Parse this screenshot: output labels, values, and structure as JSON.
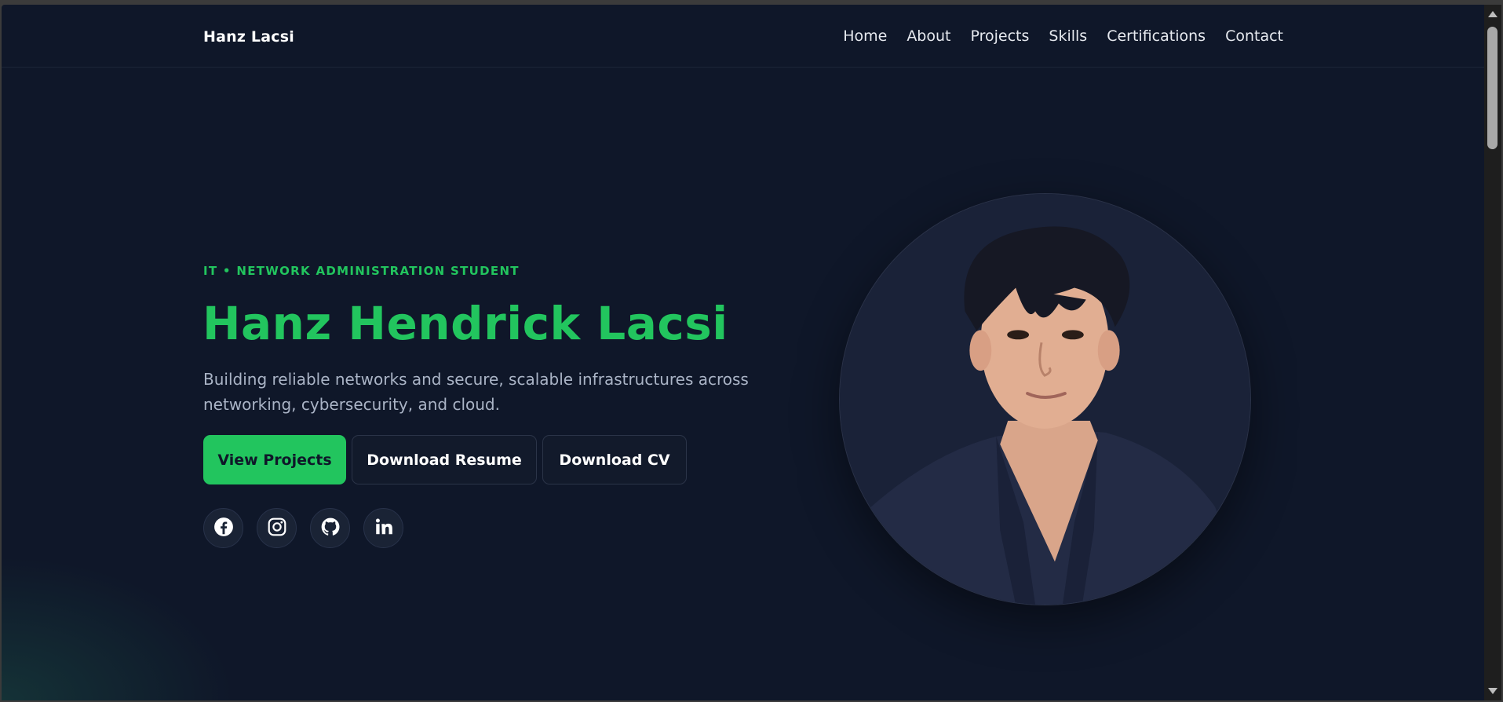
{
  "nav": {
    "brand": "Hanz Lacsi",
    "links": [
      {
        "label": "Home"
      },
      {
        "label": "About"
      },
      {
        "label": "Projects"
      },
      {
        "label": "Skills"
      },
      {
        "label": "Certifications"
      },
      {
        "label": "Contact"
      }
    ]
  },
  "hero": {
    "eyebrow": "IT • NETWORK ADMINISTRATION STUDENT",
    "name": "Hanz Hendrick Lacsi",
    "tagline": "Building reliable networks and secure, scalable infrastructures across networking, cybersecurity, and cloud.",
    "buttons": {
      "view_projects": "View Projects",
      "download_resume": "Download Resume",
      "download_cv": "Download CV"
    },
    "socials": [
      {
        "icon": "facebook-icon"
      },
      {
        "icon": "instagram-icon"
      },
      {
        "icon": "github-icon"
      },
      {
        "icon": "linkedin-icon"
      }
    ],
    "portrait_icon": "profile-photo"
  },
  "colors": {
    "background": "#0f1729",
    "accent": "#22c55e",
    "text_muted": "#aab4c6"
  }
}
